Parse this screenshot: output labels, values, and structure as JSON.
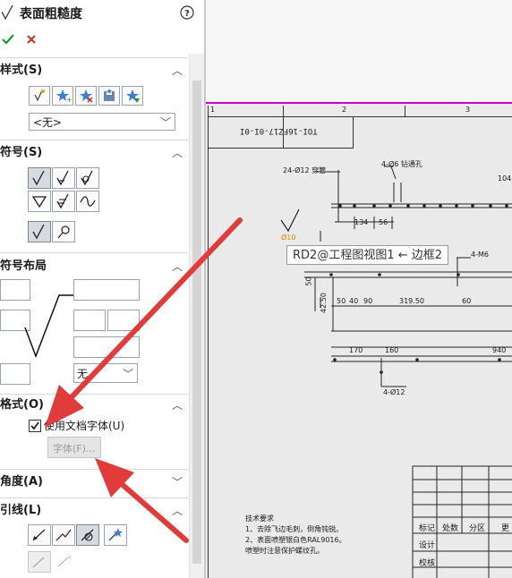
{
  "panel": {
    "title": "表面粗糙度",
    "help_icon": "help-circle-icon",
    "ok_icon": "check-icon",
    "cancel_icon": "x-icon"
  },
  "sections": {
    "style": {
      "label": "样式(S)",
      "dropdown_value": "<无>"
    },
    "symbol": {
      "label": "符号(S)"
    },
    "layout": {
      "label": "符号布局",
      "dropdown_value": "无"
    },
    "format": {
      "label": "格式(O)",
      "use_doc_font_label": "使用文档字体(U)",
      "use_doc_font_checked": true,
      "font_button_label": "字体(F)..."
    },
    "angle": {
      "label": "角度(A)"
    },
    "leader": {
      "label": "引线(L)"
    }
  },
  "drawing": {
    "sheet_cols": [
      "1",
      "2",
      "3"
    ],
    "title_block_text": "TOI-16FZ17-0I-0I",
    "tooltip": "RD2@工程图视图1 ← 边框2",
    "annotations": [
      "24-Ø12 穿管",
      "4-Ø6 钻通孔",
      "4-M6",
      "4-Ø12",
      "Ø10"
    ],
    "dims_top": [
      "134",
      "56",
      "104"
    ],
    "dims_mid": [
      "50",
      "40",
      "90",
      "319.50",
      "60"
    ],
    "dims_side": [
      "50",
      "42.50"
    ],
    "dims_bottom": [
      "170",
      "160",
      "940"
    ],
    "tech_title": "技术要求",
    "tech_lines": [
      "1、去除飞边毛刺，倒角钝锐。",
      "2、表面喷塑银白色RAL9016。",
      "喷塑时注意保护螺纹孔。"
    ],
    "table_headers": [
      "标记",
      "处数",
      "分区",
      "更"
    ],
    "table_rows": [
      "设计",
      "校核"
    ]
  },
  "colors": {
    "accent": "#1f6fc5",
    "ok": "#1a9c2a",
    "cancel": "#c8302a",
    "arrow": "#e23b3b",
    "sheet_border": "#c800c8"
  }
}
